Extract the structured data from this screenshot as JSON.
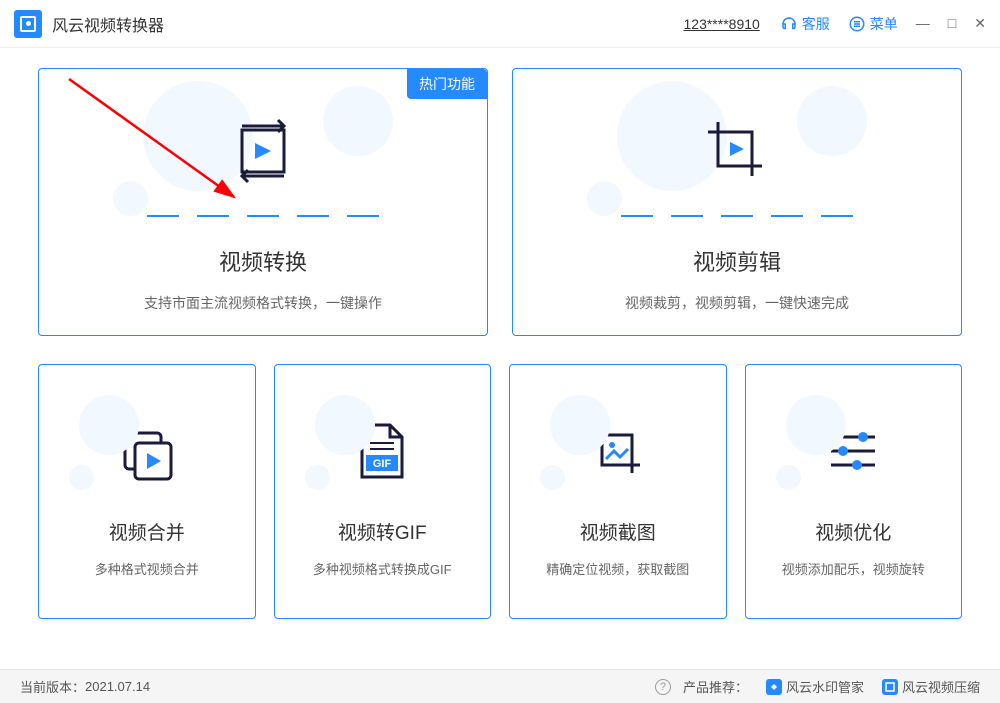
{
  "app_title": "风云视频转换器",
  "account_id": "123****8910",
  "titlebar": {
    "support": "客服",
    "menu": "菜单"
  },
  "hot_badge": "热门功能",
  "cards": {
    "convert": {
      "title": "视频转换",
      "sub": "支持市面主流视频格式转换，一键操作"
    },
    "edit": {
      "title": "视频剪辑",
      "sub": "视频裁剪，视频剪辑，一键快速完成"
    },
    "merge": {
      "title": "视频合并",
      "sub": "多种格式视频合并"
    },
    "gif": {
      "title": "视频转GIF",
      "sub": "多种视频格式转换成GIF",
      "badge": "GIF"
    },
    "screenshot": {
      "title": "视频截图",
      "sub": "精确定位视频，获取截图"
    },
    "optimize": {
      "title": "视频优化",
      "sub": "视频添加配乐，视频旋转"
    }
  },
  "footer": {
    "version_label": "当前版本：",
    "version": "2021.07.14",
    "recommend_label": "产品推荐：",
    "rec1": "风云水印管家",
    "rec2": "风云视频压缩"
  }
}
